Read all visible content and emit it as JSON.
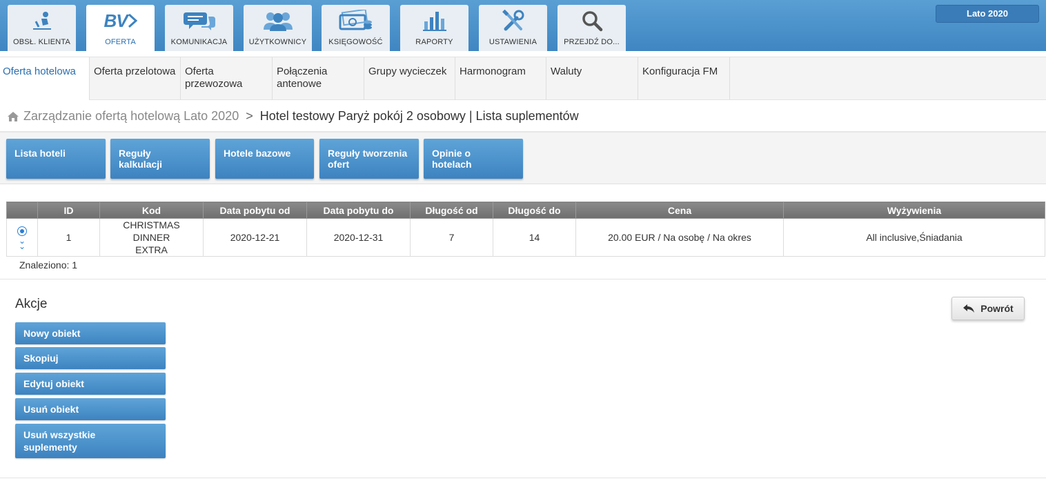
{
  "top_tabs": [
    {
      "label": "OBSŁ. KLIENTA",
      "icon": "customer-service-icon"
    },
    {
      "label": "OFERTA",
      "icon": "bv-logo-icon",
      "logo_text": "BV"
    },
    {
      "label": "KOMUNIKACJA",
      "icon": "chat-icon"
    },
    {
      "label": "UŻYTKOWNICY",
      "icon": "users-icon"
    },
    {
      "label": "KSIĘGOWOŚĆ",
      "icon": "money-icon"
    },
    {
      "label": "RAPORTY",
      "icon": "bar-chart-icon"
    },
    {
      "label": "USTAWIENIA",
      "icon": "tools-icon"
    },
    {
      "label": "PRZEJDŹ DO...",
      "icon": "search-icon"
    }
  ],
  "season": "Lato 2020",
  "submenu": [
    {
      "label": "Oferta hotelowa"
    },
    {
      "label": "Oferta przelotowa"
    },
    {
      "label": "Oferta przewozowa"
    },
    {
      "label": "Połączenia antenowe"
    },
    {
      "label": "Grupy wycieczek"
    },
    {
      "label": "Harmonogram"
    },
    {
      "label": "Waluty"
    },
    {
      "label": "Konfiguracja FM"
    }
  ],
  "breadcrumb": {
    "parent": "Zarządzanie ofertą hotelową Lato 2020",
    "separator": ">",
    "current": "Hotel testowy Paryż pokój 2 osobowy | Lista suplementów"
  },
  "toolbar": [
    {
      "label": "Lista hoteli"
    },
    {
      "label": "Reguły kalkulacji"
    },
    {
      "label": "Hotele bazowe"
    },
    {
      "label": "Reguły tworzenia ofert"
    },
    {
      "label": "Opinie o hotelach"
    }
  ],
  "table": {
    "columns": [
      "",
      "ID",
      "Kod",
      "Data pobytu od",
      "Data pobytu do",
      "Długość od",
      "Długość do",
      "Cena",
      "Wyżywienia"
    ],
    "rows": [
      {
        "id": "1",
        "kod": "CHRISTMAS DINNER EXTRA",
        "od": "2020-12-21",
        "do": "2020-12-31",
        "dl_od": "7",
        "dl_do": "14",
        "cena": "20.00 EUR / Na osobę / Na okres",
        "wyzywienia": "All inclusive,Śniadania"
      }
    ]
  },
  "found": "Znaleziono: 1",
  "actions": {
    "title": "Akcje",
    "buttons": [
      {
        "label": "Nowy obiekt"
      },
      {
        "label": "Skopiuj"
      },
      {
        "label": "Edytuj obiekt"
      },
      {
        "label": "Usuń obiekt"
      },
      {
        "label": "Usuń wszystkie suplementy"
      }
    ]
  },
  "back_button": "Powrót",
  "colors": {
    "accent": "#3d83c0",
    "topbar": "#4a90c8",
    "header": "#7a7a7a"
  }
}
